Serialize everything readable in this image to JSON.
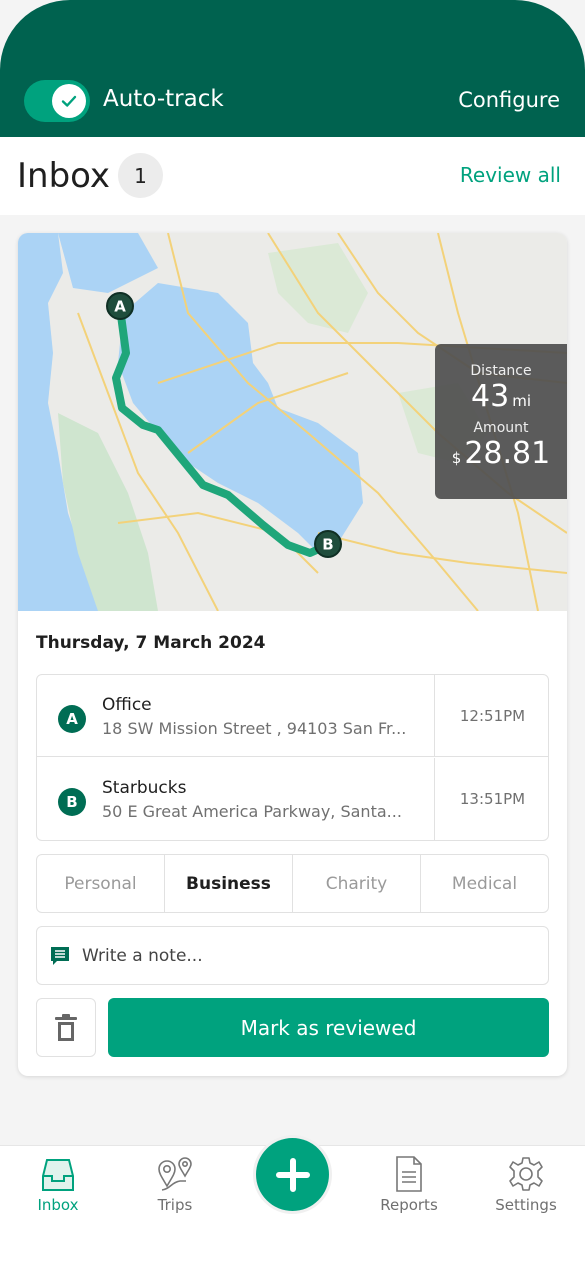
{
  "header": {
    "autotrack_label": "Auto-track",
    "autotrack_on": true,
    "configure_label": "Configure"
  },
  "inbox": {
    "title": "Inbox",
    "count": "1",
    "review_all_label": "Review all"
  },
  "trip": {
    "map": {
      "start_marker": "A",
      "end_marker": "B"
    },
    "stats": {
      "distance_label": "Distance",
      "distance_value": "43",
      "distance_unit": "mi",
      "amount_label": "Amount",
      "amount_currency": "$",
      "amount_value": "28.81"
    },
    "date": "Thursday, 7 March 2024",
    "stops": [
      {
        "marker": "A",
        "name": "Office",
        "address": "18 SW Mission Street , 94103 San Fr...",
        "time": "12:51PM"
      },
      {
        "marker": "B",
        "name": "Starbucks",
        "address": "50 E Great America Parkway, Santa...",
        "time": "13:51PM"
      }
    ],
    "categories": [
      {
        "label": "Personal",
        "selected": false
      },
      {
        "label": "Business",
        "selected": true
      },
      {
        "label": "Charity",
        "selected": false
      },
      {
        "label": "Medical",
        "selected": false
      }
    ],
    "note_placeholder": "Write a note...",
    "mark_reviewed_label": "Mark as reviewed"
  },
  "tabbar": {
    "items": [
      {
        "label": "Inbox",
        "icon": "inbox-tray-icon",
        "active": true
      },
      {
        "label": "Trips",
        "icon": "map-pins-icon",
        "active": false
      },
      {
        "label": "Reports",
        "icon": "document-icon",
        "active": false
      },
      {
        "label": "Settings",
        "icon": "gear-icon",
        "active": false
      }
    ],
    "fab_icon": "plus-icon"
  },
  "colors": {
    "header_bg": "#00624f",
    "accent": "#00a27e",
    "marker": "#006d54",
    "route": "#1fa67a"
  }
}
